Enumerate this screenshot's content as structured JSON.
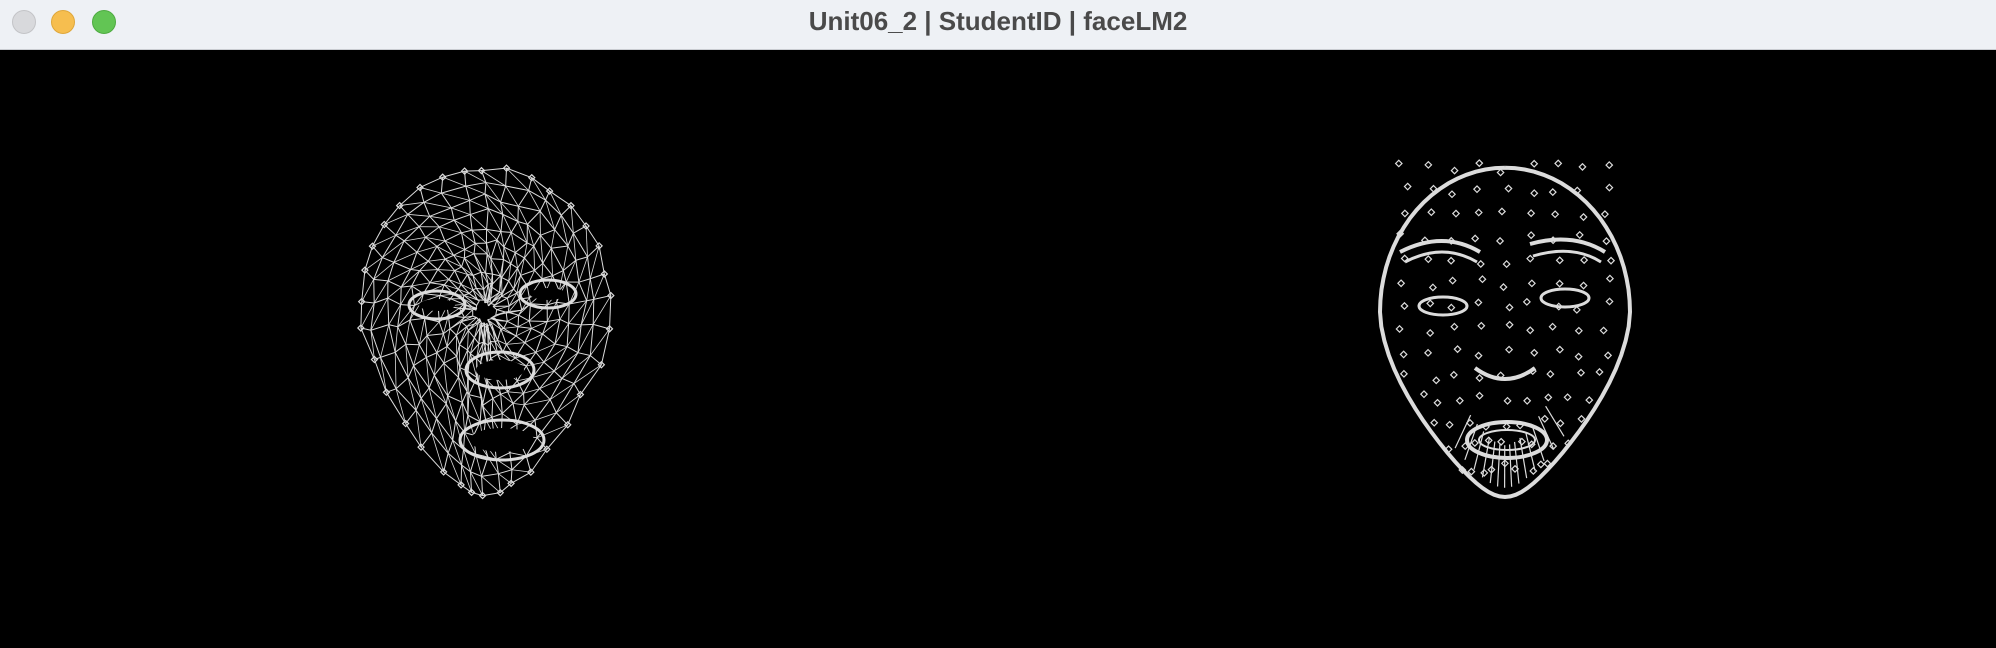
{
  "window": {
    "title": "Unit06_2 | StudentID | faceLM2"
  },
  "controls": {
    "close": "close-button",
    "minimize": "minimize-button",
    "zoom": "zoom-button"
  },
  "colors": {
    "canvas_bg": "#000000",
    "mesh": "#dcdcdc",
    "titlebar_bg": "#eef1f5",
    "title_text": "#4a4a4a"
  },
  "panels": [
    {
      "name": "face-mesh-tessellation",
      "style": "tessellation"
    },
    {
      "name": "face-landmarks-contours",
      "style": "contours"
    }
  ]
}
